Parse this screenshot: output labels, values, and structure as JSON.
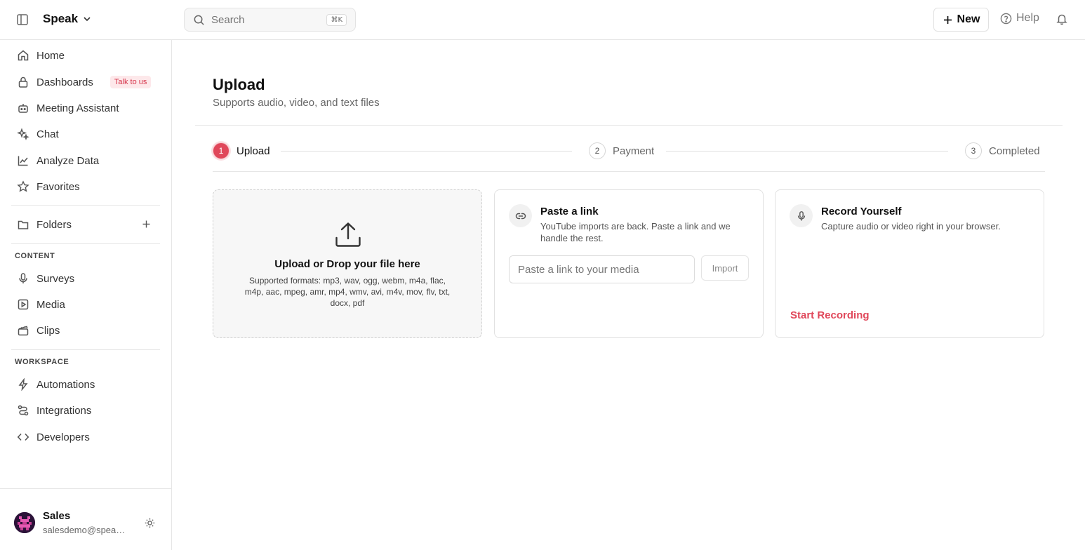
{
  "app": {
    "workspace_name": "Speak"
  },
  "header": {
    "search_placeholder": "Search",
    "search_shortcut": "⌘K",
    "new_label": "New",
    "help_label": "Help"
  },
  "sidebar": {
    "items": [
      {
        "label": "Home",
        "icon": "home-icon"
      },
      {
        "label": "Dashboards",
        "icon": "lock-icon",
        "badge": "Talk to us"
      },
      {
        "label": "Meeting Assistant",
        "icon": "bot-icon"
      },
      {
        "label": "Chat",
        "icon": "sparkles-icon"
      },
      {
        "label": "Analyze Data",
        "icon": "chart-line-icon"
      },
      {
        "label": "Favorites",
        "icon": "star-icon"
      }
    ],
    "folders_label": "Folders",
    "content_section_label": "CONTENT",
    "content_items": [
      {
        "label": "Surveys",
        "icon": "microphone-icon"
      },
      {
        "label": "Media",
        "icon": "play-square-icon"
      },
      {
        "label": "Clips",
        "icon": "clapperboard-icon"
      }
    ],
    "workspace_section_label": "WORKSPACE",
    "workspace_items": [
      {
        "label": "Automations",
        "icon": "bolt-icon"
      },
      {
        "label": "Integrations",
        "icon": "route-icon"
      },
      {
        "label": "Developers",
        "icon": "code-icon"
      }
    ],
    "user": {
      "name": "Sales",
      "email": "salesdemo@speak..."
    }
  },
  "main": {
    "title": "Upload",
    "subtitle": "Supports audio, video, and text files",
    "steps": [
      {
        "number": "1",
        "label": "Upload",
        "active": true
      },
      {
        "number": "2",
        "label": "Payment",
        "active": false
      },
      {
        "number": "3",
        "label": "Completed",
        "active": false
      }
    ],
    "upload_card": {
      "title": "Upload or Drop your file here",
      "formats": "Supported formats: mp3, wav, ogg, webm, m4a, flac, m4p, aac, mpeg, amr, mp4, wmv, avi, m4v, mov, flv, txt, docx, pdf"
    },
    "link_card": {
      "title": "Paste a link",
      "description": "YouTube imports are back. Paste a link and we handle the rest.",
      "input_placeholder": "Paste a link to your media",
      "import_label": "Import"
    },
    "record_card": {
      "title": "Record Yourself",
      "description": "Capture audio or video right in your browser.",
      "start_label": "Start Recording"
    }
  },
  "colors": {
    "accent": "#e0475a",
    "badge_bg": "#fde8ea",
    "border": "#e6e6e6"
  }
}
